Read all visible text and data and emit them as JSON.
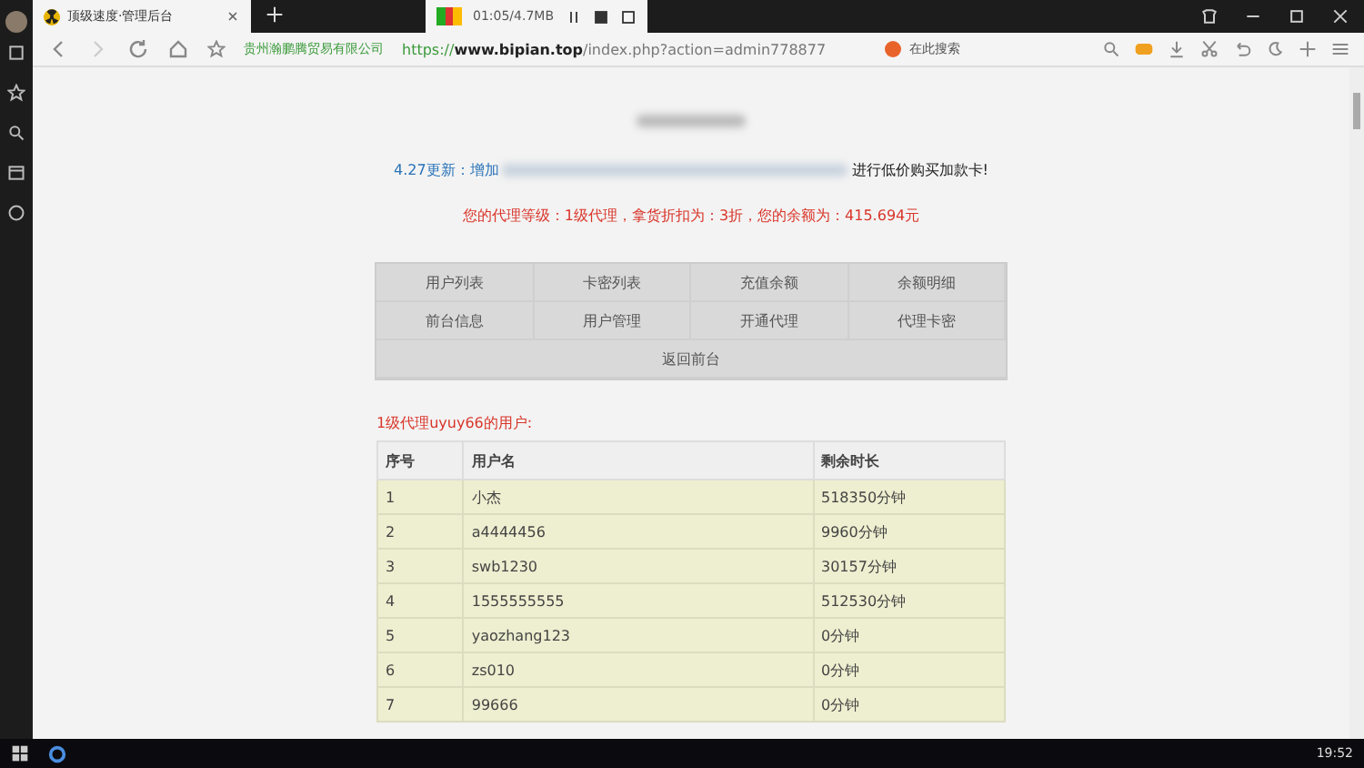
{
  "browser": {
    "tab_title": "顶级速度·管理后台",
    "recorder": {
      "time": "01:05/4.7MB"
    },
    "site_name": "贵州瀚鹏腾贸易有限公司",
    "url_host": "https://www.bipian.top",
    "url_path": "/index.php?action=admin778877",
    "search_placeholder": "在此搜索"
  },
  "page": {
    "notice_prefix": "4.27更新：增加",
    "notice_suffix": "进行低价购买加款卡!",
    "agent_info": "您的代理等级：1级代理，拿货折扣为：3折，您的余额为：415.694元",
    "menu": [
      {
        "label": "用户列表"
      },
      {
        "label": "卡密列表"
      },
      {
        "label": "充值余额"
      },
      {
        "label": "余额明细"
      },
      {
        "label": "前台信息"
      },
      {
        "label": "用户管理"
      },
      {
        "label": "开通代理"
      },
      {
        "label": "代理卡密"
      }
    ],
    "back_link": "返回前台",
    "users_heading": "1级代理uyuy66的用户:",
    "table": {
      "columns": [
        "序号",
        "用户名",
        "剩余时长"
      ],
      "rows": [
        [
          "1",
          "小杰",
          "518350分钟"
        ],
        [
          "2",
          "a4444456",
          "9960分钟"
        ],
        [
          "3",
          "swb1230",
          "30157分钟"
        ],
        [
          "4",
          "1555555555",
          "512530分钟"
        ],
        [
          "5",
          "yaozhang123",
          "0分钟"
        ],
        [
          "6",
          "zs010",
          "0分钟"
        ],
        [
          "7",
          "99666",
          "0分钟"
        ]
      ]
    }
  },
  "taskbar": {
    "time": "19:52"
  }
}
